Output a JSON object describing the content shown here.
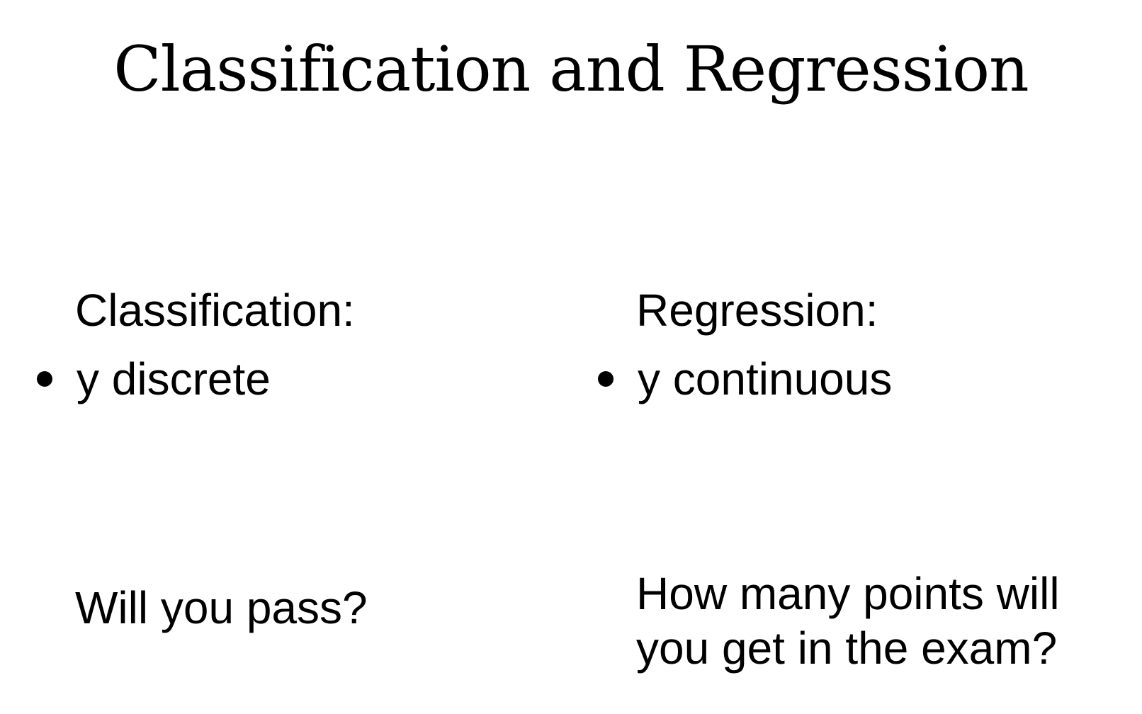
{
  "slide": {
    "title": "Classification and Regression",
    "columns": [
      {
        "heading": "Classification:",
        "bullet": "y discrete",
        "question": "Will you pass?"
      },
      {
        "heading": "Regression:",
        "bullet": "y continuous",
        "question": "How many points will you get in the exam?"
      }
    ]
  }
}
